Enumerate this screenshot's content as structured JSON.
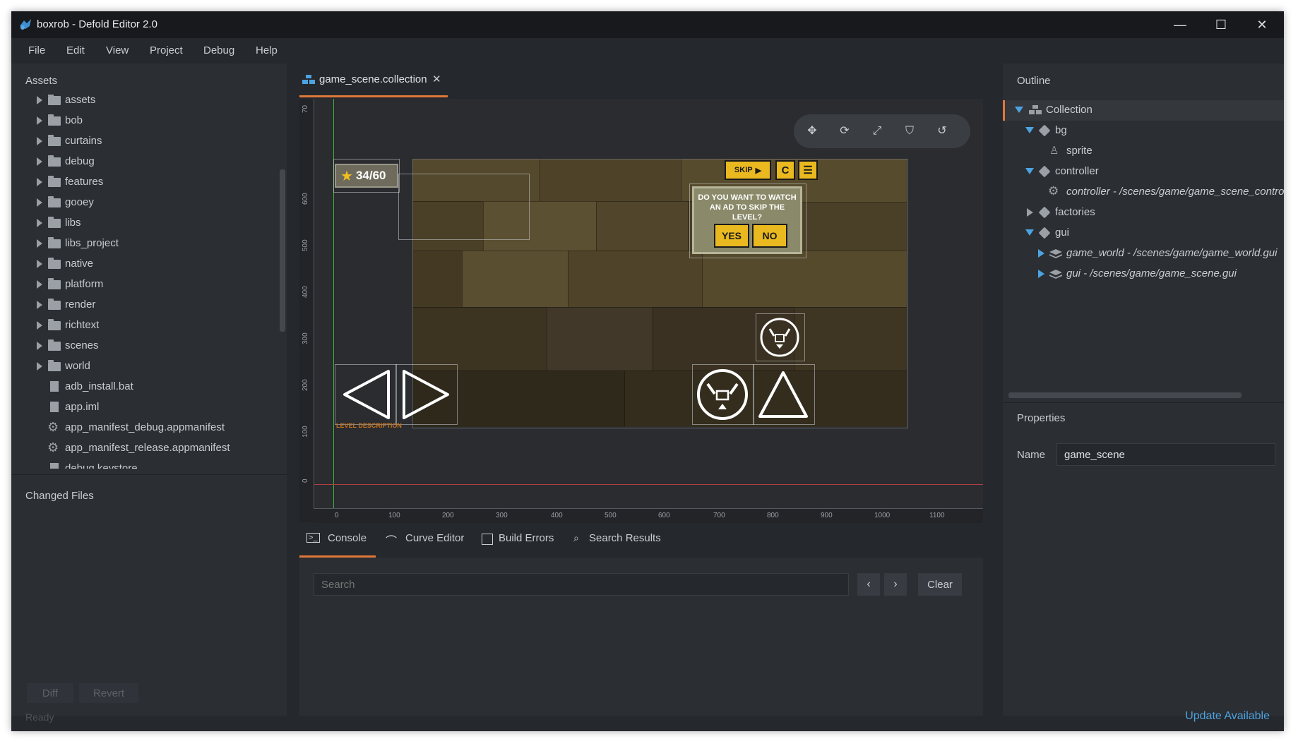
{
  "window": {
    "title": "boxrob - Defold Editor 2.0",
    "minimize": "—",
    "maximize": "☐",
    "close": "✕"
  },
  "menu": [
    "File",
    "Edit",
    "View",
    "Project",
    "Debug",
    "Help"
  ],
  "assets": {
    "title": "Assets",
    "folders": [
      "assets",
      "bob",
      "curtains",
      "debug",
      "features",
      "gooey",
      "libs",
      "libs_project",
      "native",
      "platform",
      "render",
      "richtext",
      "scenes",
      "world"
    ],
    "files": [
      {
        "name": "adb_install.bat",
        "icon": "file-icon"
      },
      {
        "name": "app.iml",
        "icon": "file-icon"
      },
      {
        "name": "app_manifest_debug.appmanifest",
        "icon": "gear-icon"
      },
      {
        "name": "app_manifest_release.appmanifest",
        "icon": "gear-icon"
      },
      {
        "name": "debug.keystore",
        "icon": "file-icon"
      }
    ]
  },
  "changed_files": {
    "title": "Changed Files",
    "diff": "Diff",
    "revert": "Revert"
  },
  "editor": {
    "tab": {
      "label": "game_scene.collection",
      "close": "✕"
    },
    "ruler_y": [
      "0",
      "100",
      "200",
      "300",
      "400",
      "500",
      "600",
      "70"
    ],
    "ruler_x": [
      "0",
      "100",
      "200",
      "300",
      "400",
      "500",
      "600",
      "700",
      "800",
      "900",
      "1000",
      "1100"
    ],
    "scene": {
      "score": "34/60",
      "skip": "SKIP",
      "restart": "C",
      "popup_line1": "DO YOU WANT TO WATCH",
      "popup_line2": "AN AD TO SKIP THE LEVEL?",
      "yes": "YES",
      "no": "NO",
      "level_desc": "LEVEL DESCRIPTION"
    }
  },
  "bottom_tabs": [
    "Console",
    "Curve Editor",
    "Build Errors",
    "Search Results"
  ],
  "console": {
    "search_placeholder": "Search",
    "prev": "‹",
    "next": "›",
    "clear": "Clear"
  },
  "outline": {
    "title": "Outline",
    "items": [
      {
        "label": "Collection",
        "level": 0
      },
      {
        "label": "bg",
        "level": 1
      },
      {
        "label": "sprite",
        "level": 2
      },
      {
        "label": "controller",
        "level": 1
      },
      {
        "label": "controller - /scenes/game/game_scene_contro",
        "level": 2
      },
      {
        "label": "factories",
        "level": 1
      },
      {
        "label": "gui",
        "level": 1
      },
      {
        "label": "game_world - /scenes/game/game_world.gui",
        "level": 2
      },
      {
        "label": "gui - /scenes/game/game_scene.gui",
        "level": 2
      }
    ]
  },
  "properties": {
    "title": "Properties",
    "name_label": "Name",
    "name_value": "game_scene"
  },
  "status": {
    "left": "Ready",
    "right": "Update Available"
  },
  "colors": {
    "accent": "#e0783a",
    "link": "#4da3e0",
    "panel": "#2b2e33"
  }
}
